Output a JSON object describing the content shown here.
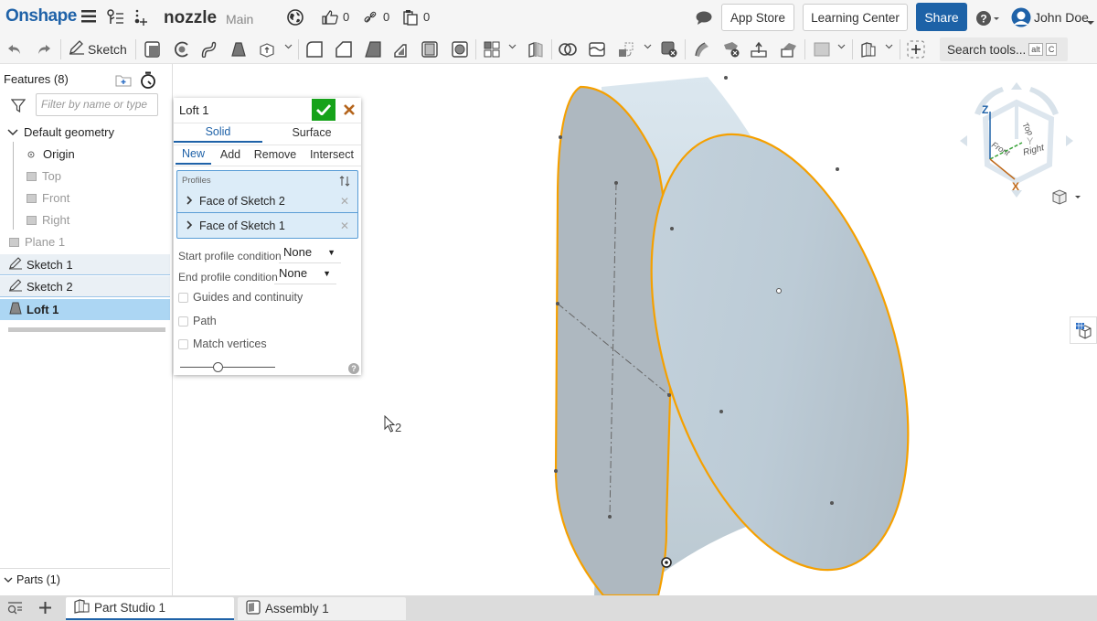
{
  "app": {
    "logo": "Onshape",
    "document_title": "nozzle",
    "branch": "Main",
    "likes_count": "0",
    "links_count": "0",
    "copies_count": "0",
    "buttons": {
      "app_store": "App Store",
      "learning_center": "Learning Center",
      "share": "Share"
    },
    "user_name": "John Doe",
    "colors": {
      "brand": "#1f62a8",
      "accept": "#16a21a",
      "cancel": "#b5651d",
      "selection_edge": "#f5a000",
      "body_fill": "#b4c1ca"
    }
  },
  "toolbar": {
    "sketch_label": "Sketch",
    "search_tools_label": "Search tools...",
    "search_kbd": [
      "alt",
      "C"
    ],
    "icons": [
      "undo-icon",
      "redo-icon",
      "sketch-icon",
      "extrude-icon",
      "revolve-icon",
      "sweep-icon",
      "loft-icon",
      "thicken-icon",
      "fillet-icon",
      "chamfer-icon",
      "draft-icon",
      "rib-icon",
      "shell-icon",
      "hole-icon",
      "pattern-icon",
      "mirror-icon",
      "boolean-icon",
      "split-icon",
      "transform-icon",
      "delete-part-icon",
      "modify-fillet-icon",
      "delete-face-icon",
      "move-face-icon",
      "replace-face-icon",
      "plane-icon",
      "mate-connector-icon",
      "add-custom-feature-icon"
    ]
  },
  "features_panel": {
    "title": "Features (8)",
    "filter_placeholder": "Filter by name or type",
    "default_geometry_label": "Default geometry",
    "items": [
      {
        "label": "Origin",
        "type": "origin",
        "faded": false
      },
      {
        "label": "Top",
        "type": "plane",
        "faded": true
      },
      {
        "label": "Front",
        "type": "plane",
        "faded": true
      },
      {
        "label": "Right",
        "type": "plane",
        "faded": true
      },
      {
        "label": "Plane 1",
        "type": "plane",
        "faded": true
      },
      {
        "label": "Sketch 1",
        "type": "sketch",
        "faded": false
      },
      {
        "label": "Sketch 2",
        "type": "sketch",
        "faded": false
      },
      {
        "label": "Loft 1",
        "type": "loft",
        "faded": false,
        "active": true
      }
    ],
    "parts_label": "Parts (1)"
  },
  "loft_dialog": {
    "title": "Loft 1",
    "body_types": [
      "Solid",
      "Surface"
    ],
    "active_body_type": "Solid",
    "operations": [
      "New",
      "Add",
      "Remove",
      "Intersect"
    ],
    "active_operation": "New",
    "profiles_label": "Profiles",
    "profiles": [
      "Face of Sketch 2",
      "Face of Sketch 1"
    ],
    "start_condition_label": "Start profile condition",
    "start_condition_value": "None",
    "end_condition_label": "End profile condition",
    "end_condition_value": "None",
    "checkboxes": [
      {
        "label": "Guides and continuity",
        "checked": false
      },
      {
        "label": "Path",
        "checked": false
      },
      {
        "label": "Match vertices",
        "checked": false
      }
    ],
    "slider_value_fraction": 0.4
  },
  "view_cube": {
    "faces": [
      "Top",
      "Front",
      "Right"
    ],
    "axes": [
      "X",
      "Y",
      "Z"
    ]
  },
  "viewport": {
    "cursor_selection_count": "2"
  },
  "bottom_tabs": [
    {
      "label": "Part Studio 1",
      "active": true
    },
    {
      "label": "Assembly 1",
      "active": false
    }
  ]
}
